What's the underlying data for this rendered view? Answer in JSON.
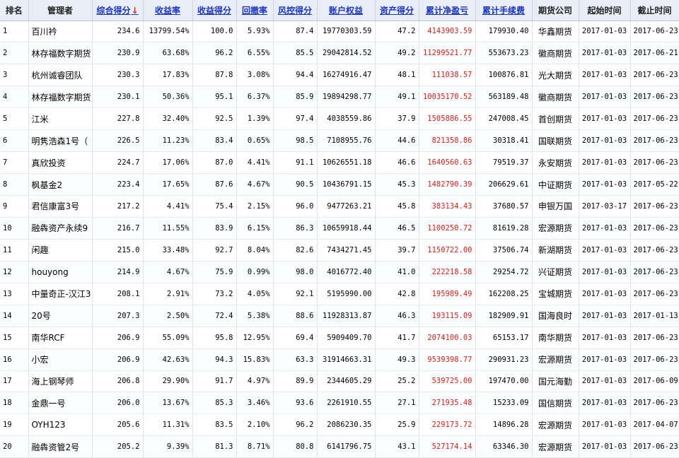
{
  "headers": {
    "rank": "排名",
    "manager": "管理者",
    "composite": "综合得分",
    "composite_arrow": "↓",
    "return_rate": "收益率",
    "return_score": "收益得分",
    "drawdown": "回撤率",
    "risk_score": "风控得分",
    "equity": "账户权益",
    "asset_score": "资产得分",
    "net_profit": "累计净盈亏",
    "fees": "累计手续费",
    "company": "期货公司",
    "start": "起始时间",
    "end": "截止时间"
  },
  "colors": {
    "accent_red": "#e0211b",
    "link_blue": "#1a34c8",
    "header_bg": "#e9eef6"
  },
  "rows": [
    {
      "rank": "1",
      "manager": "百川衿",
      "composite": "234.6",
      "return_rate": "13799.54%",
      "return_score": "100.0",
      "drawdown": "5.93%",
      "risk_score": "87.4",
      "equity": "19770303.59",
      "asset_score": "47.2",
      "net_profit": "4143903.59",
      "fees": "179930.40",
      "company": "华鑫期货",
      "start": "2017-01-03",
      "end": "2017-06-23"
    },
    {
      "rank": "2",
      "manager": "林存福数字期货",
      "composite": "230.9",
      "return_rate": "63.68%",
      "return_score": "96.2",
      "drawdown": "6.55%",
      "risk_score": "85.5",
      "equity": "29042814.52",
      "asset_score": "49.2",
      "net_profit": "11299521.77",
      "fees": "553673.23",
      "company": "徽商期货",
      "start": "2017-01-03",
      "end": "2017-06-21"
    },
    {
      "rank": "3",
      "manager": "杭州诚睿团队",
      "composite": "230.3",
      "return_rate": "17.83%",
      "return_score": "87.8",
      "drawdown": "3.08%",
      "risk_score": "94.4",
      "equity": "16274916.47",
      "asset_score": "48.1",
      "net_profit": "111038.57",
      "fees": "100876.81",
      "company": "光大期货",
      "start": "2017-01-03",
      "end": "2017-06-23"
    },
    {
      "rank": "4",
      "manager": "林存福数字期货",
      "composite": "230.1",
      "return_rate": "50.36%",
      "return_score": "95.1",
      "drawdown": "6.37%",
      "risk_score": "85.9",
      "equity": "19894298.77",
      "asset_score": "49.1",
      "net_profit": "10035170.52",
      "fees": "563189.48",
      "company": "徽商期货",
      "start": "2017-01-03",
      "end": "2017-06-23"
    },
    {
      "rank": "5",
      "manager": "江米",
      "composite": "227.8",
      "return_rate": "32.40%",
      "return_score": "92.5",
      "drawdown": "1.39%",
      "risk_score": "97.4",
      "equity": "4038559.86",
      "asset_score": "37.9",
      "net_profit": "1505886.55",
      "fees": "247008.45",
      "company": "首创期货",
      "start": "2017-01-03",
      "end": "2017-06-23"
    },
    {
      "rank": "6",
      "manager": "明隽浩森1号（",
      "composite": "226.5",
      "return_rate": "11.23%",
      "return_score": "83.4",
      "drawdown": "0.65%",
      "risk_score": "98.5",
      "equity": "7108955.76",
      "asset_score": "44.6",
      "net_profit": "821358.86",
      "fees": "30318.41",
      "company": "国联期货",
      "start": "2017-01-03",
      "end": "2017-06-23"
    },
    {
      "rank": "7",
      "manager": "真欣投资",
      "composite": "224.7",
      "return_rate": "17.06%",
      "return_score": "87.0",
      "drawdown": "4.41%",
      "risk_score": "91.1",
      "equity": "10626551.18",
      "asset_score": "46.6",
      "net_profit": "1640560.63",
      "fees": "79519.37",
      "company": "永安期货",
      "start": "2017-01-03",
      "end": "2017-06-23"
    },
    {
      "rank": "8",
      "manager": "枫基金2",
      "composite": "223.4",
      "return_rate": "17.65%",
      "return_score": "87.6",
      "drawdown": "4.67%",
      "risk_score": "90.5",
      "equity": "10436791.15",
      "asset_score": "45.3",
      "net_profit": "1482790.39",
      "fees": "206629.61",
      "company": "中证期货",
      "start": "2017-01-03",
      "end": "2017-05-22"
    },
    {
      "rank": "9",
      "manager": "君信康富3号",
      "composite": "217.2",
      "return_rate": "4.41%",
      "return_score": "75.4",
      "drawdown": "2.15%",
      "risk_score": "96.0",
      "equity": "9477263.21",
      "asset_score": "45.8",
      "net_profit": "383134.43",
      "fees": "37680.57",
      "company": "申银万国",
      "start": "2017-03-17",
      "end": "2017-06-23"
    },
    {
      "rank": "10",
      "manager": "融犇资产永续9",
      "composite": "216.7",
      "return_rate": "11.55%",
      "return_score": "83.9",
      "drawdown": "6.15%",
      "risk_score": "86.3",
      "equity": "10659918.44",
      "asset_score": "46.5",
      "net_profit": "1100250.72",
      "fees": "81619.28",
      "company": "宏源期货",
      "start": "2017-01-03",
      "end": "2017-06-23"
    },
    {
      "rank": "11",
      "manager": "闲趣",
      "composite": "215.0",
      "return_rate": "33.48%",
      "return_score": "92.7",
      "drawdown": "8.04%",
      "risk_score": "82.6",
      "equity": "7434271.45",
      "asset_score": "39.7",
      "net_profit": "1150722.00",
      "fees": "37506.74",
      "company": "新湖期货",
      "start": "2017-01-03",
      "end": "2017-06-23"
    },
    {
      "rank": "12",
      "manager": "houyong",
      "composite": "214.9",
      "return_rate": "4.67%",
      "return_score": "75.9",
      "drawdown": "0.99%",
      "risk_score": "98.0",
      "equity": "4016772.40",
      "asset_score": "41.0",
      "net_profit": "222218.58",
      "fees": "29254.72",
      "company": "兴证期货",
      "start": "2017-01-03",
      "end": "2017-06-23"
    },
    {
      "rank": "13",
      "manager": "中量奇正-汉江3",
      "composite": "208.1",
      "return_rate": "2.91%",
      "return_score": "73.2",
      "drawdown": "4.05%",
      "risk_score": "92.1",
      "equity": "5195990.00",
      "asset_score": "42.8",
      "net_profit": "195989.49",
      "fees": "162208.25",
      "company": "宝城期货",
      "start": "2017-01-03",
      "end": "2017-06-23"
    },
    {
      "rank": "14",
      "manager": "20号",
      "composite": "207.3",
      "return_rate": "2.50%",
      "return_score": "72.4",
      "drawdown": "5.38%",
      "risk_score": "88.6",
      "equity": "11928313.87",
      "asset_score": "46.3",
      "net_profit": "193115.09",
      "fees": "182909.91",
      "company": "国海良时",
      "start": "2017-01-03",
      "end": "2017-01-13"
    },
    {
      "rank": "15",
      "manager": "南华RCF",
      "composite": "206.9",
      "return_rate": "55.09%",
      "return_score": "95.8",
      "drawdown": "12.95%",
      "risk_score": "69.4",
      "equity": "5909409.70",
      "asset_score": "41.7",
      "net_profit": "2074100.03",
      "fees": "65153.17",
      "company": "南华期货",
      "start": "2017-01-03",
      "end": "2017-06-23"
    },
    {
      "rank": "16",
      "manager": "小宏",
      "composite": "206.9",
      "return_rate": "42.63%",
      "return_score": "94.3",
      "drawdown": "15.83%",
      "risk_score": "63.3",
      "equity": "31914663.31",
      "asset_score": "49.3",
      "net_profit": "9539398.77",
      "fees": "290931.23",
      "company": "宏源期货",
      "start": "2017-01-03",
      "end": "2017-06-23"
    },
    {
      "rank": "17",
      "manager": "海上钢琴师",
      "composite": "206.8",
      "return_rate": "29.90%",
      "return_score": "91.7",
      "drawdown": "4.97%",
      "risk_score": "89.9",
      "equity": "2344605.29",
      "asset_score": "25.2",
      "net_profit": "539725.00",
      "fees": "197470.00",
      "company": "国元海勤",
      "start": "2017-01-03",
      "end": "2017-06-09"
    },
    {
      "rank": "18",
      "manager": "金鼎一号",
      "composite": "206.0",
      "return_rate": "13.67%",
      "return_score": "85.3",
      "drawdown": "3.46%",
      "risk_score": "93.6",
      "equity": "2261910.55",
      "asset_score": "27.1",
      "net_profit": "271935.48",
      "fees": "15233.09",
      "company": "国信期货",
      "start": "2017-01-03",
      "end": "2017-06-23"
    },
    {
      "rank": "19",
      "manager": "OYH123",
      "composite": "205.6",
      "return_rate": "11.31%",
      "return_score": "83.5",
      "drawdown": "2.10%",
      "risk_score": "96.2",
      "equity": "2086230.35",
      "asset_score": "25.9",
      "net_profit": "229173.72",
      "fees": "14896.28",
      "company": "宏源期货",
      "start": "2017-01-03",
      "end": "2017-04-07"
    },
    {
      "rank": "20",
      "manager": "融犇资管2号",
      "composite": "205.2",
      "return_rate": "9.39%",
      "return_score": "81.3",
      "drawdown": "8.71%",
      "risk_score": "80.8",
      "equity": "6141796.75",
      "asset_score": "43.1",
      "net_profit": "527174.14",
      "fees": "63346.30",
      "company": "宏源期货",
      "start": "2017-01-03",
      "end": "2017-06-23"
    }
  ]
}
